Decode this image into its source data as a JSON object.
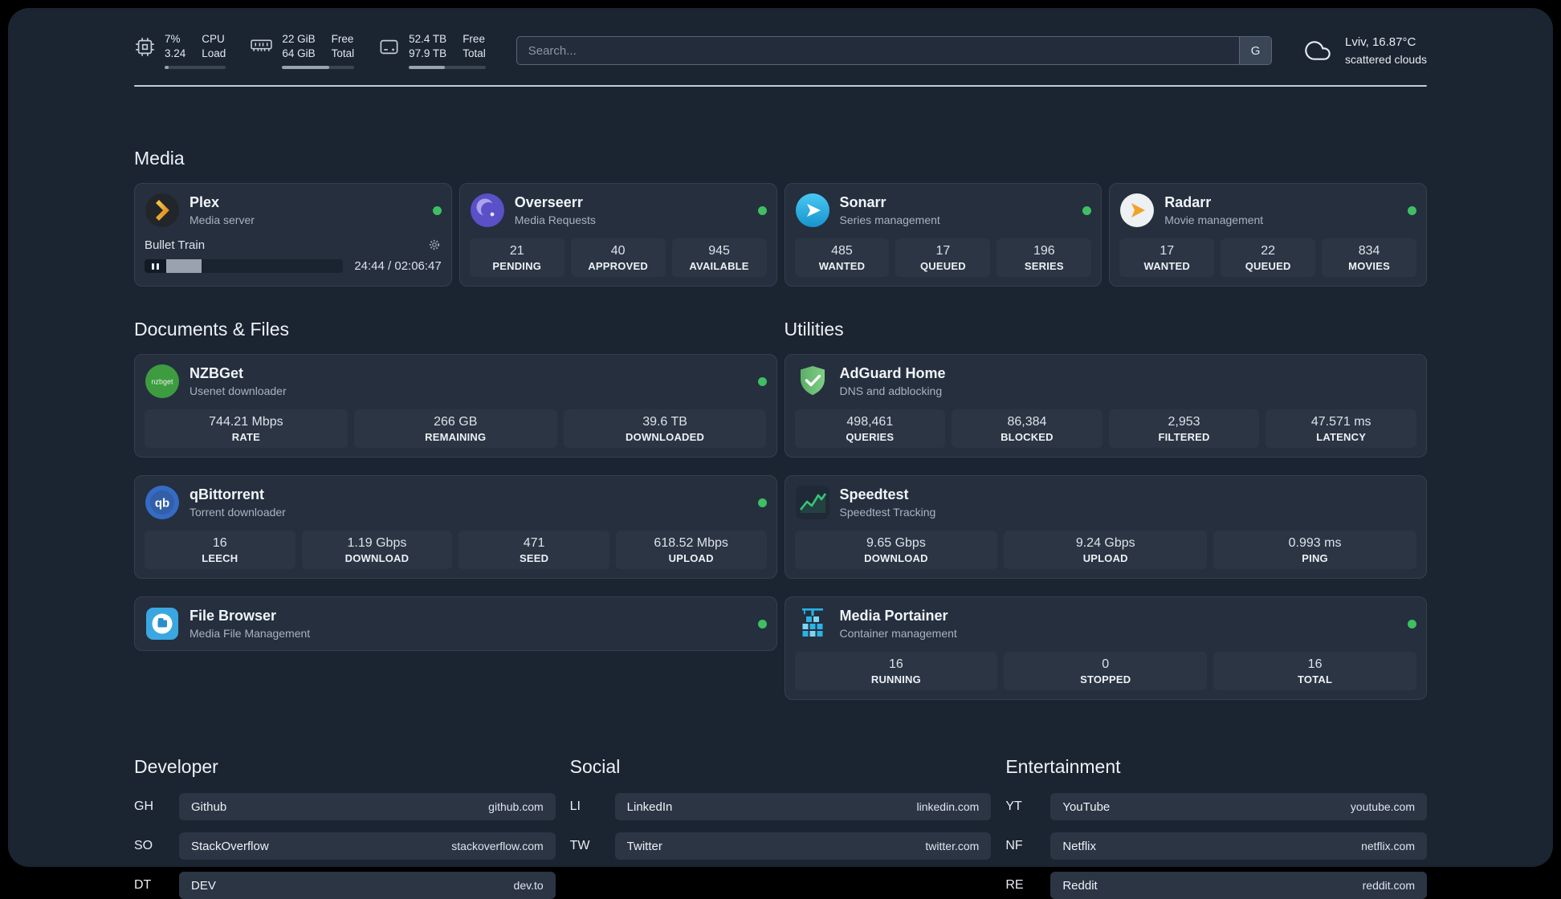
{
  "header": {
    "cpu": {
      "percent": "7%",
      "load": "3.24",
      "label_a": "CPU",
      "label_b": "Load",
      "progress": 7
    },
    "ram": {
      "free": "22 GiB",
      "total": "64 GiB",
      "label_a": "Free",
      "label_b": "Total",
      "progress": 65
    },
    "disk": {
      "free": "52.4 TB",
      "total": "97.9 TB",
      "label_a": "Free",
      "label_b": "Total",
      "progress": 47
    },
    "search": {
      "placeholder": "Search...",
      "button_label": "G"
    },
    "weather": {
      "location": "Lviv, 16.87°C",
      "condition": "scattered clouds"
    }
  },
  "colors": {
    "status_online": "#3fbf62",
    "plex_gold": "#e5a00d",
    "background": "#1b2431",
    "card": "#252f3e"
  },
  "icons": {
    "nzbget_label": "nzbget",
    "qbittorrent_label": "qb"
  },
  "media": {
    "section_title": "Media",
    "plex": {
      "name": "Plex",
      "subtitle": "Media server",
      "now_playing": "Bullet Train",
      "time": "24:44 / 02:06:47",
      "progress": 20
    },
    "overseerr": {
      "name": "Overseerr",
      "subtitle": "Media Requests",
      "stats": [
        {
          "value": "21",
          "label": "PENDING"
        },
        {
          "value": "40",
          "label": "APPROVED"
        },
        {
          "value": "945",
          "label": "AVAILABLE"
        }
      ]
    },
    "sonarr": {
      "name": "Sonarr",
      "subtitle": "Series management",
      "stats": [
        {
          "value": "485",
          "label": "WANTED"
        },
        {
          "value": "17",
          "label": "QUEUED"
        },
        {
          "value": "196",
          "label": "SERIES"
        }
      ]
    },
    "radarr": {
      "name": "Radarr",
      "subtitle": "Movie management",
      "stats": [
        {
          "value": "17",
          "label": "WANTED"
        },
        {
          "value": "22",
          "label": "QUEUED"
        },
        {
          "value": "834",
          "label": "MOVIES"
        }
      ]
    }
  },
  "documents": {
    "section_title": "Documents & Files",
    "nzbget": {
      "name": "NZBGet",
      "subtitle": "Usenet downloader",
      "stats": [
        {
          "value": "744.21 Mbps",
          "label": "RATE"
        },
        {
          "value": "266 GB",
          "label": "REMAINING"
        },
        {
          "value": "39.6 TB",
          "label": "DOWNLOADED"
        }
      ]
    },
    "qbittorrent": {
      "name": "qBittorrent",
      "subtitle": "Torrent downloader",
      "stats": [
        {
          "value": "16",
          "label": "LEECH"
        },
        {
          "value": "1.19 Gbps",
          "label": "DOWNLOAD"
        },
        {
          "value": "471",
          "label": "SEED"
        },
        {
          "value": "618.52 Mbps",
          "label": "UPLOAD"
        }
      ]
    },
    "filebrowser": {
      "name": "File Browser",
      "subtitle": "Media File Management"
    }
  },
  "utilities": {
    "section_title": "Utilities",
    "adguard": {
      "name": "AdGuard Home",
      "subtitle": "DNS and adblocking",
      "stats": [
        {
          "value": "498,461",
          "label": "QUERIES"
        },
        {
          "value": "86,384",
          "label": "BLOCKED"
        },
        {
          "value": "2,953",
          "label": "FILTERED"
        },
        {
          "value": "47.571 ms",
          "label": "LATENCY"
        }
      ]
    },
    "speedtest": {
      "name": "Speedtest",
      "subtitle": "Speedtest Tracking",
      "stats": [
        {
          "value": "9.65 Gbps",
          "label": "DOWNLOAD"
        },
        {
          "value": "9.24 Gbps",
          "label": "UPLOAD"
        },
        {
          "value": "0.993 ms",
          "label": "PING"
        }
      ]
    },
    "portainer": {
      "name": "Media Portainer",
      "subtitle": "Container management",
      "stats": [
        {
          "value": "16",
          "label": "RUNNING"
        },
        {
          "value": "0",
          "label": "STOPPED"
        },
        {
          "value": "16",
          "label": "TOTAL"
        }
      ]
    }
  },
  "links": {
    "developer": {
      "section_title": "Developer",
      "items": [
        {
          "abbr": "GH",
          "name": "Github",
          "domain": "github.com"
        },
        {
          "abbr": "SO",
          "name": "StackOverflow",
          "domain": "stackoverflow.com"
        },
        {
          "abbr": "DT",
          "name": "DEV",
          "domain": "dev.to"
        }
      ]
    },
    "social": {
      "section_title": "Social",
      "items": [
        {
          "abbr": "LI",
          "name": "LinkedIn",
          "domain": "linkedin.com"
        },
        {
          "abbr": "TW",
          "name": "Twitter",
          "domain": "twitter.com"
        }
      ]
    },
    "entertainment": {
      "section_title": "Entertainment",
      "items": [
        {
          "abbr": "YT",
          "name": "YouTube",
          "domain": "youtube.com"
        },
        {
          "abbr": "NF",
          "name": "Netflix",
          "domain": "netflix.com"
        },
        {
          "abbr": "RE",
          "name": "Reddit",
          "domain": "reddit.com"
        }
      ]
    }
  }
}
